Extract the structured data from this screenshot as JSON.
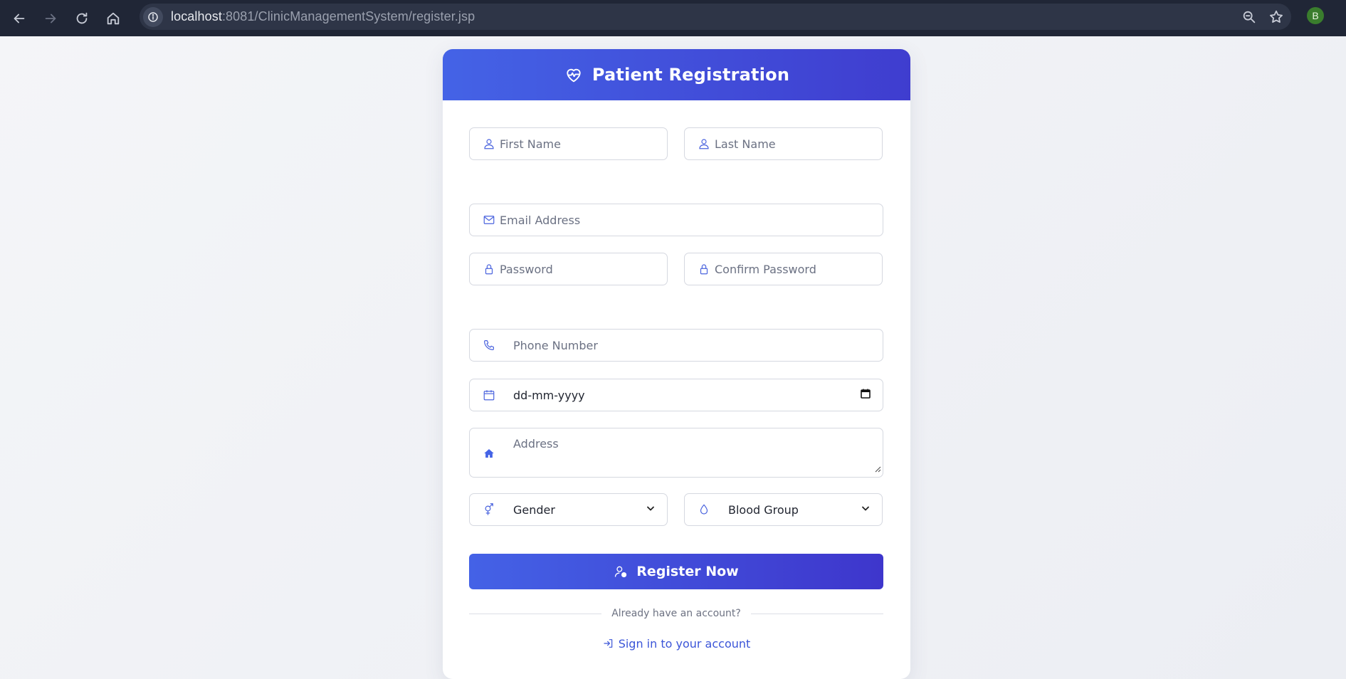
{
  "browser": {
    "url_host": "localhost",
    "url_rest": ":8081/ClinicManagementSystem/register.jsp",
    "profile_initial": "B",
    "icons": [
      "back-icon",
      "forward-icon",
      "reload-icon",
      "home-icon",
      "info-icon",
      "zoom-icon",
      "star-icon"
    ]
  },
  "header": {
    "title": "Patient Registration",
    "icon": "heart-pulse-icon"
  },
  "form": {
    "first_name": {
      "placeholder": "First Name",
      "icon": "person-icon"
    },
    "last_name": {
      "placeholder": "Last Name",
      "icon": "person-icon"
    },
    "email": {
      "placeholder": "Email Address",
      "icon": "envelope-icon"
    },
    "password": {
      "placeholder": "Password",
      "icon": "lock-icon"
    },
    "confirm_password": {
      "placeholder": "Confirm Password",
      "icon": "lock-icon"
    },
    "phone": {
      "placeholder": "Phone Number",
      "icon": "phone-icon"
    },
    "dob": {
      "value": "dd-mm-yyyy",
      "icon": "calendar-icon"
    },
    "address": {
      "placeholder": "Address",
      "icon": "house-icon"
    },
    "gender": {
      "selected": "Gender",
      "icon": "gender-icon"
    },
    "blood_group": {
      "selected": "Blood Group",
      "icon": "droplet-icon"
    }
  },
  "actions": {
    "register_label": "Register Now",
    "divider_text": "Already have an account?",
    "signin_label": "Sign in to your account"
  },
  "colors": {
    "accent": "#4462e6",
    "accent_dark": "#3e36cc",
    "link": "#3b55d8",
    "chrome_bg": "#202636"
  }
}
